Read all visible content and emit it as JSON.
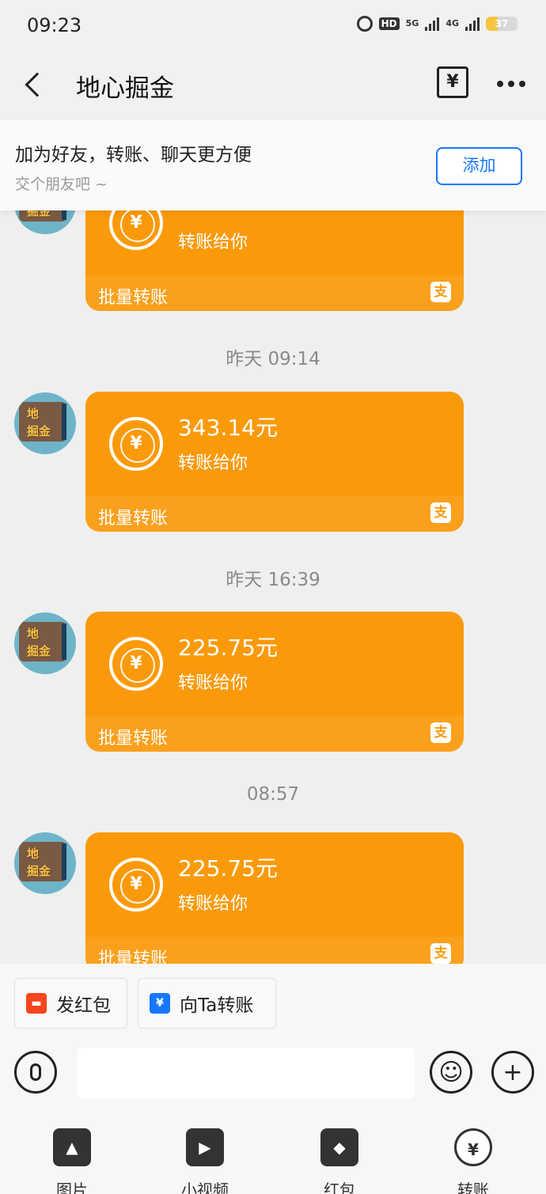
{
  "status_bar": {
    "time": "09:23",
    "network_1": "5G",
    "network_2": "4G",
    "hd": "HD",
    "battery": "37"
  },
  "nav": {
    "title": "地心掘金",
    "transfer_glyph": "¥"
  },
  "banner": {
    "title": "加为好友，转账、聊天更方便",
    "subtitle": "交个朋友吧 ~",
    "add_label": "添加"
  },
  "avatar": {
    "line1": "地",
    "line2": "掘金"
  },
  "messages": [
    {
      "amount": "",
      "desc": "转账给你",
      "footer": "批量转账"
    },
    {
      "amount": "343.14元",
      "desc": "转账给你",
      "footer": "批量转账"
    },
    {
      "amount": "225.75元",
      "desc": "转账给你",
      "footer": "批量转账"
    },
    {
      "amount": "225.75元",
      "desc": "转账给你",
      "footer": "批量转账"
    }
  ],
  "timestamps": [
    "昨天 09:14",
    "昨天 16:39",
    "08:57"
  ],
  "quick_actions": {
    "red_packet": "发红包",
    "transfer": "向Ta转账"
  },
  "input": {
    "placeholder": ""
  },
  "tools": [
    {
      "label": "图片",
      "icon": "image-icon"
    },
    {
      "label": "小视频",
      "icon": "video-icon"
    },
    {
      "label": "红包",
      "icon": "red-packet-icon"
    },
    {
      "label": "转账",
      "icon": "transfer-icon"
    }
  ],
  "colors": {
    "bubble": "#fa9a0a",
    "bubble_footer": "#fba01c",
    "accent_blue": "#1677ff",
    "red_packet": "#f7451c"
  }
}
